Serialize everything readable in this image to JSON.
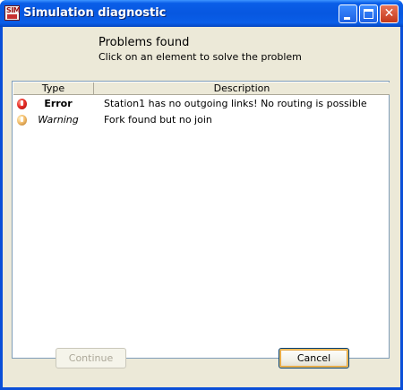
{
  "window": {
    "title": "Simulation diagnostic",
    "app_icon_text": "SIM"
  },
  "header": {
    "title": "Problems found",
    "subtitle": "Click on an element to solve the problem"
  },
  "table": {
    "columns": [
      "Type",
      "Description"
    ],
    "rows": [
      {
        "icon": "error-icon",
        "type": "Error",
        "description": "Station1 has no outgoing links! No routing is possible"
      },
      {
        "icon": "warning-icon",
        "type": "Warning",
        "description": "Fork found but no join"
      }
    ]
  },
  "buttons": {
    "continue_label": "Continue",
    "continue_enabled": false,
    "cancel_label": "Cancel"
  },
  "colors": {
    "titlebar": "#0757e0",
    "dialog_bg": "#ece9d8",
    "error": "#e8302a",
    "warning": "#f4c070"
  }
}
